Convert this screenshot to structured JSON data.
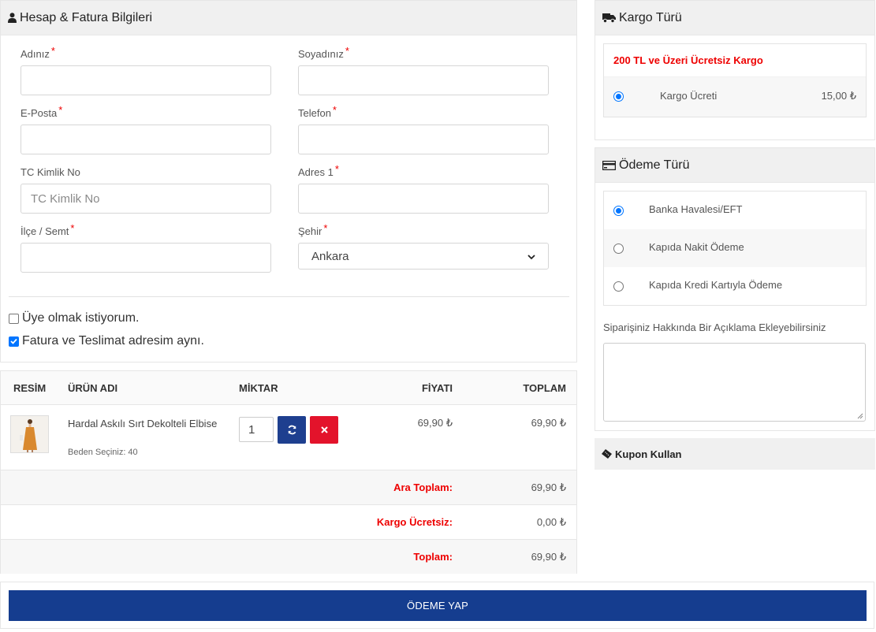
{
  "account": {
    "title": "Hesap & Fatura Bilgileri",
    "fields": {
      "first_name": {
        "label": "Adınız",
        "required": "*",
        "value": ""
      },
      "last_name": {
        "label": "Soyadınız",
        "required": "*",
        "value": ""
      },
      "email": {
        "label": "E-Posta",
        "required": "*",
        "value": ""
      },
      "phone": {
        "label": "Telefon",
        "required": "*",
        "value": ""
      },
      "tc_no": {
        "label": "TC Kimlik No",
        "placeholder": "TC Kimlik No",
        "value": ""
      },
      "address": {
        "label": "Adres 1",
        "required": "*",
        "value": ""
      },
      "district": {
        "label": "İlçe / Semt",
        "required": "*",
        "value": ""
      },
      "city": {
        "label": "Şehir",
        "required": "*",
        "selected": "Ankara"
      }
    },
    "checkboxes": {
      "member": {
        "label": "Üye olmak istiyorum.",
        "checked": false
      },
      "same_address": {
        "label": "Fatura ve Teslimat adresim aynı.",
        "checked": true
      }
    }
  },
  "cart": {
    "headers": {
      "image": "RESİM",
      "name": "ÜRÜN ADI",
      "qty": "MİKTAR",
      "price": "FİYATI",
      "total": "TOPLAM"
    },
    "item": {
      "name": "Hardal Askılı Sırt Dekolteli Elbise",
      "variant": "Beden Seçiniz: 40",
      "quantity": "1",
      "price": "69,90 ₺",
      "total": "69,90 ₺"
    },
    "summary": {
      "subtotal_label": "Ara Toplam:",
      "subtotal_value": "69,90 ₺",
      "shipping_label": "Kargo Ücretsiz:",
      "shipping_value": "0,00 ₺",
      "total_label": "Toplam:",
      "total_value": "69,90 ₺"
    }
  },
  "pay_button": "ÖDEME YAP",
  "shipping": {
    "title": "Kargo Türü",
    "promo": "200 TL ve Üzeri Ücretsiz Kargo",
    "option_label": "Kargo Ücreti",
    "option_price": "15,00 ₺"
  },
  "payment": {
    "title": "Ödeme Türü",
    "options": [
      {
        "label": "Banka Havalesi/EFT",
        "selected": true
      },
      {
        "label": "Kapıda Nakit Ödeme",
        "selected": false
      },
      {
        "label": "Kapıda Kredi Kartıyla Ödeme",
        "selected": false
      }
    ],
    "note_label": "Siparişiniz Hakkında Bir Açıklama Ekleyebilirsiniz",
    "note_value": ""
  },
  "coupon": {
    "title": "Kupon Kullan"
  },
  "colors": {
    "primary": "#153d8f",
    "danger": "#e3132b",
    "required": "#ee0000",
    "radio": "#0075ff"
  }
}
